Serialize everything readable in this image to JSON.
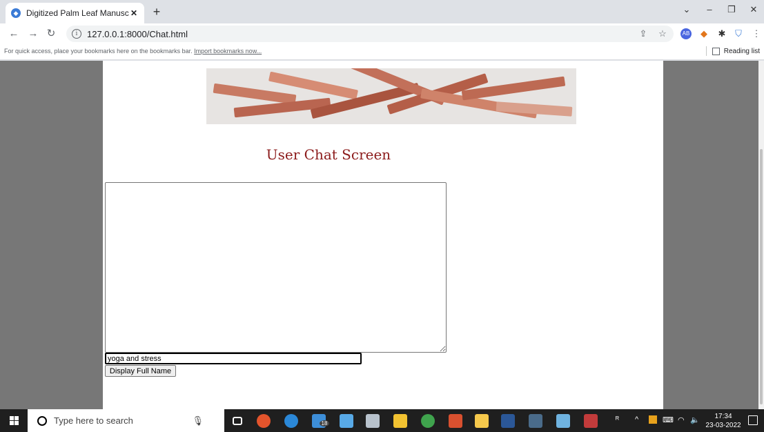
{
  "browser": {
    "tab_title": "Digitized Palm Leaf Manuscript S",
    "tab_close": "✕",
    "new_tab": "+",
    "url": "127.0.0.1:8000/Chat.html",
    "bookmarks_hint": "For quick access, place your bookmarks here on the bookmarks bar.",
    "bookmarks_link": "Import bookmarks now...",
    "reading_list": "Reading list"
  },
  "page": {
    "heading": "User Chat Screen",
    "chat_log_value": "",
    "message_value": "yoga and stress",
    "send_button_label": "Display Full Name"
  },
  "taskbar": {
    "search_placeholder": "Type here to search",
    "mail_badge": "18",
    "time": "17:34",
    "date": "23-03-2022"
  }
}
